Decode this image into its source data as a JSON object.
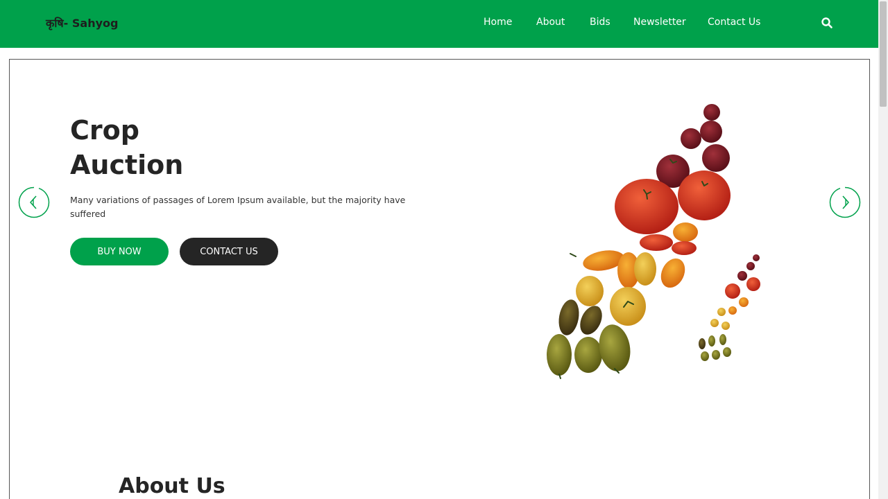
{
  "header": {
    "logo": "कृषि- Sahyog",
    "nav": [
      {
        "label": "Home"
      },
      {
        "label": "About"
      },
      {
        "label": "Bids"
      },
      {
        "label": "Newsletter"
      },
      {
        "label": "Contact Us"
      }
    ],
    "search_icon": "search-icon"
  },
  "hero": {
    "title_line1": "Crop",
    "title_line2": "Auction",
    "description": "Many variations of passages of Lorem Ipsum available, but the majority have suffered",
    "buy_label": "BUY NOW",
    "contact_label": "CONTACT US",
    "prev_icon": "chevron-left-icon",
    "next_icon": "chevron-right-icon",
    "image": "tomatoes-image"
  },
  "about": {
    "title": "About Us"
  },
  "colors": {
    "brand_green": "#00a14b",
    "dark": "#252525",
    "white": "#ffffff"
  }
}
